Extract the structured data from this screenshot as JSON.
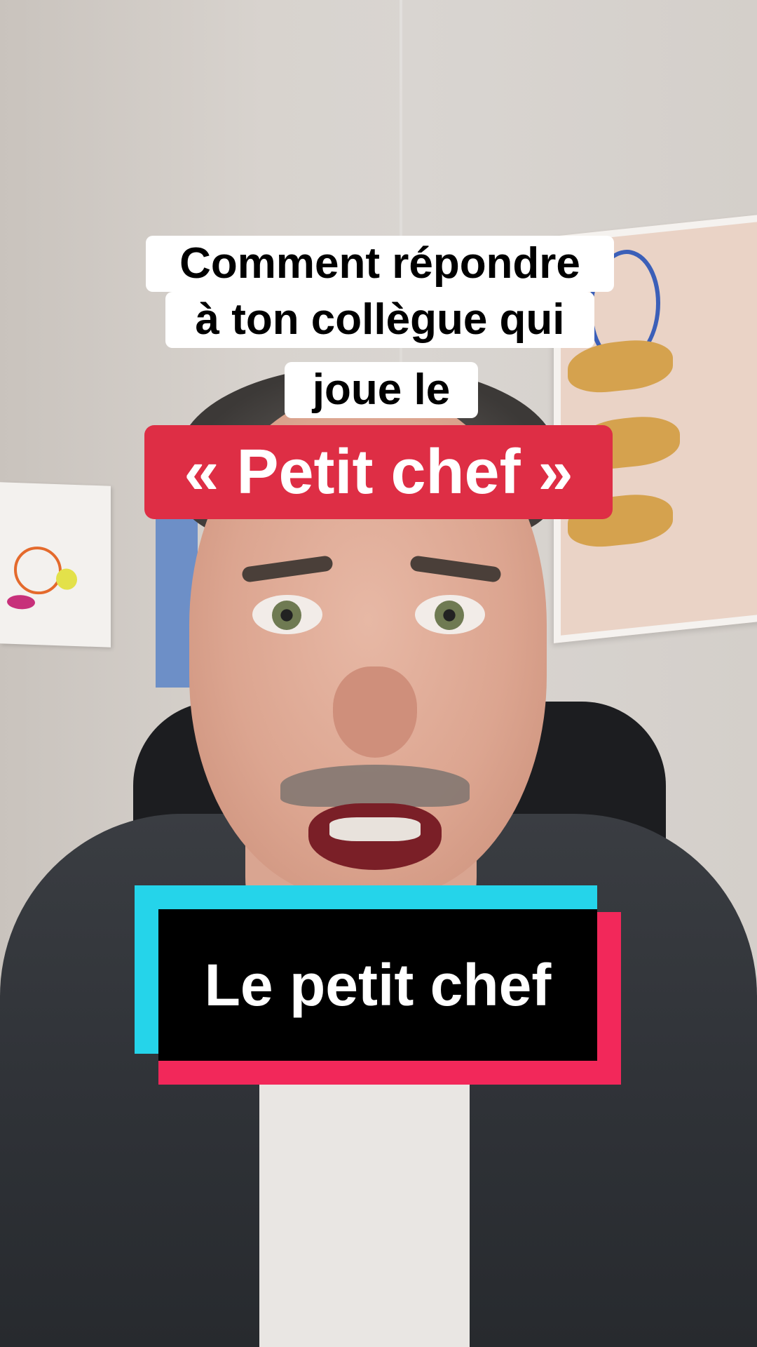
{
  "caption_top": {
    "line1": "Comment répondre",
    "line2": "à ton collègue qui",
    "line3": "joue le"
  },
  "caption_highlight": "« Petit chef »",
  "title_card": "Le petit chef",
  "colors": {
    "highlight_red": "#de2e45",
    "brand_cyan": "#25d4ea",
    "brand_pink": "#f2285a"
  }
}
